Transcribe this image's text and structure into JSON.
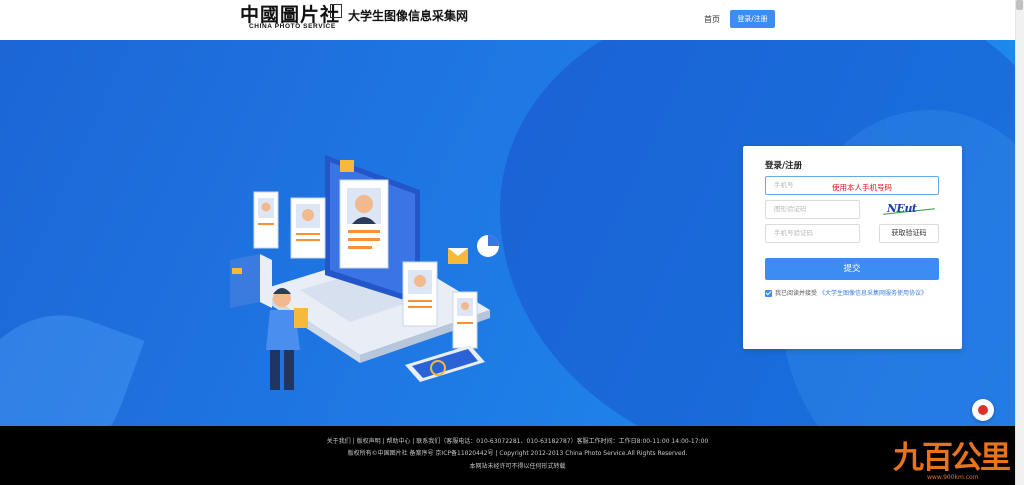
{
  "header": {
    "logo_cn": "中國圖片社",
    "logo_en": "CHINA PHOTO SERVICE",
    "site_name": "大学生图像信息采集网",
    "nav_home": "首页",
    "nav_login": "登录/注册"
  },
  "login": {
    "title": "登录/注册",
    "phone_placeholder": "手机号",
    "phone_tip": "使用本人手机号码",
    "captcha_placeholder": "图形验证码",
    "captcha_text": "NEut",
    "sms_placeholder": "手机号验证码",
    "sms_button": "获取验证码",
    "submit": "提交",
    "agree_prefix": "我已阅读并接受",
    "agree_link": "《大学生图像信息采集网服务使用协议》"
  },
  "footer": {
    "line1": "关于我们 | 版权声明 | 帮助中心 | 联系我们（客服电话：010-63072281、010-63182787）客服工作时间：工作日8:00-11:00 14:00-17:00",
    "line2": "版权所有©中国图片社 备案序号 京ICP备11020442号 | Copyright 2012-2013 China Photo Service.All Rights Reserved.",
    "line3": "本网站未经许可不得以任何形式转载"
  },
  "watermark": {
    "text": "九百公里",
    "url": "www.900km.com"
  },
  "colors": {
    "accent": "#3d8cf4",
    "hero_start": "#1c66d6",
    "hero_end": "#1b8ff0",
    "tip_red": "#e4151b",
    "footer_bg": "#000000"
  },
  "icons": {
    "captcha": "captcha-image",
    "service": "customer-service-icon",
    "checkbox": "checkbox-checked-icon"
  }
}
